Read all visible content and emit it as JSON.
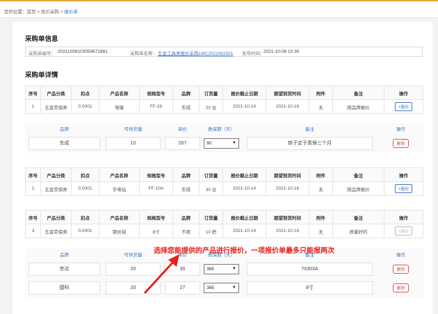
{
  "breadcrumb": {
    "prefix": "您的位置：",
    "home": "首页",
    "sep1": " > ",
    "section": "竞价采购",
    "sep2": " > ",
    "current": "报价单"
  },
  "info": {
    "title": "采购单信息",
    "no_label": "采购单编号：",
    "no_value": "20211008103059671881",
    "name_label": "采购单名称：",
    "name_value": "五金工具类报价采购LMC2021081501",
    "time_label": "发布时间：",
    "time_value": "2021-10-08 10:30"
  },
  "details": {
    "title": "采购单详情",
    "headers": [
      "序号",
      "产品分类",
      "扣点",
      "产品名称",
      "规格型号",
      "品牌",
      "订货量",
      "报价截止日期",
      "期望到货时间",
      "附件",
      "备注",
      "操作"
    ],
    "add_label": "+报价",
    "items": [
      {
        "cells": [
          "1",
          "五金劳保类",
          "0.0001",
          "电锤",
          "FF-26",
          "东成",
          "20 台",
          "2021-10-14",
          "2021-10-16",
          "无",
          "按品牌报价"
        ]
      },
      {
        "cells": [
          "2",
          "五金劳保类",
          "0.0001",
          "手电钻",
          "FF-10A",
          "东成",
          "30 台",
          "2021-10-14",
          "2021-10-16",
          "无",
          "按品牌报价"
        ]
      },
      {
        "cells": [
          "3",
          "五金劳保类",
          "0.0001",
          "钢丝钳",
          "8寸",
          "不限",
          "10 把",
          "2021-10-14",
          "2021-10-16",
          "无",
          "质量好的"
        ]
      }
    ]
  },
  "quote_headers": [
    "品牌",
    "可供货量",
    "单价",
    "质保期（天）",
    "备注",
    "操作"
  ],
  "delete_label": "删除",
  "quotes1": [
    {
      "brand": "东成",
      "qty": "10",
      "price": "267",
      "warranty": "90",
      "remark": "转子定子质保三个月"
    }
  ],
  "quotes3": [
    {
      "brand": "世达",
      "qty": "20",
      "price": "30",
      "warranty": "365",
      "remark": "70303A"
    },
    {
      "brand": "捷科",
      "qty": "20",
      "price": "27",
      "warranty": "365",
      "remark": "8寸"
    }
  ],
  "annotation": "选择您能提供的产品进行报价，一项报价单最多只能报两次",
  "colors": {
    "accent": "#3a78c8",
    "danger": "#d9534f",
    "annotation": "#e8201a",
    "topbar": "#e8a33a"
  }
}
